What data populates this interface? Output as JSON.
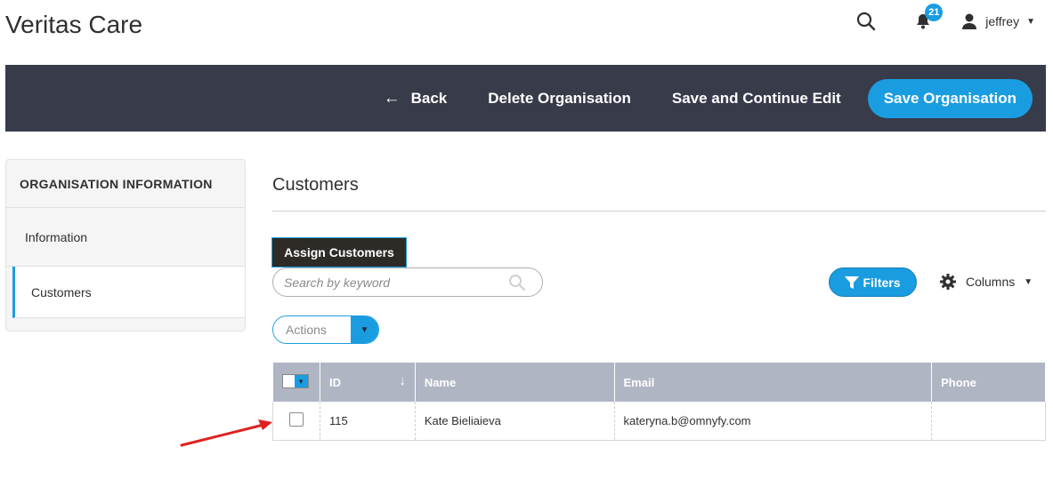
{
  "app": {
    "title": "Veritas Care"
  },
  "header": {
    "notifications_count": "21",
    "user_name": "jeffrey"
  },
  "action_bar": {
    "back_label": "Back",
    "delete_label": "Delete Organisation",
    "save_continue_label": "Save and Continue Edit",
    "save_label": "Save Organisation"
  },
  "sidebar": {
    "title": "ORGANISATION INFORMATION",
    "items": [
      {
        "label": "Information",
        "active": false
      },
      {
        "label": "Customers",
        "active": true
      }
    ]
  },
  "main": {
    "section_title": "Customers",
    "assign_label": "Assign Customers",
    "search_placeholder": "Search by keyword",
    "filters_label": "Filters",
    "columns_label": "Columns",
    "actions_label": "Actions",
    "table": {
      "columns": [
        "ID",
        "Name",
        "Email",
        "Phone"
      ],
      "rows": [
        {
          "id": "115",
          "name": "Kate Bieliaieva",
          "email": "kateryna.b@omnyfy.com",
          "phone": ""
        }
      ]
    }
  },
  "colors": {
    "accent": "#1a9de0",
    "action_bar": "#373b4a",
    "table_header": "#b0b5c4",
    "annotation_arrow": "#e02020"
  }
}
